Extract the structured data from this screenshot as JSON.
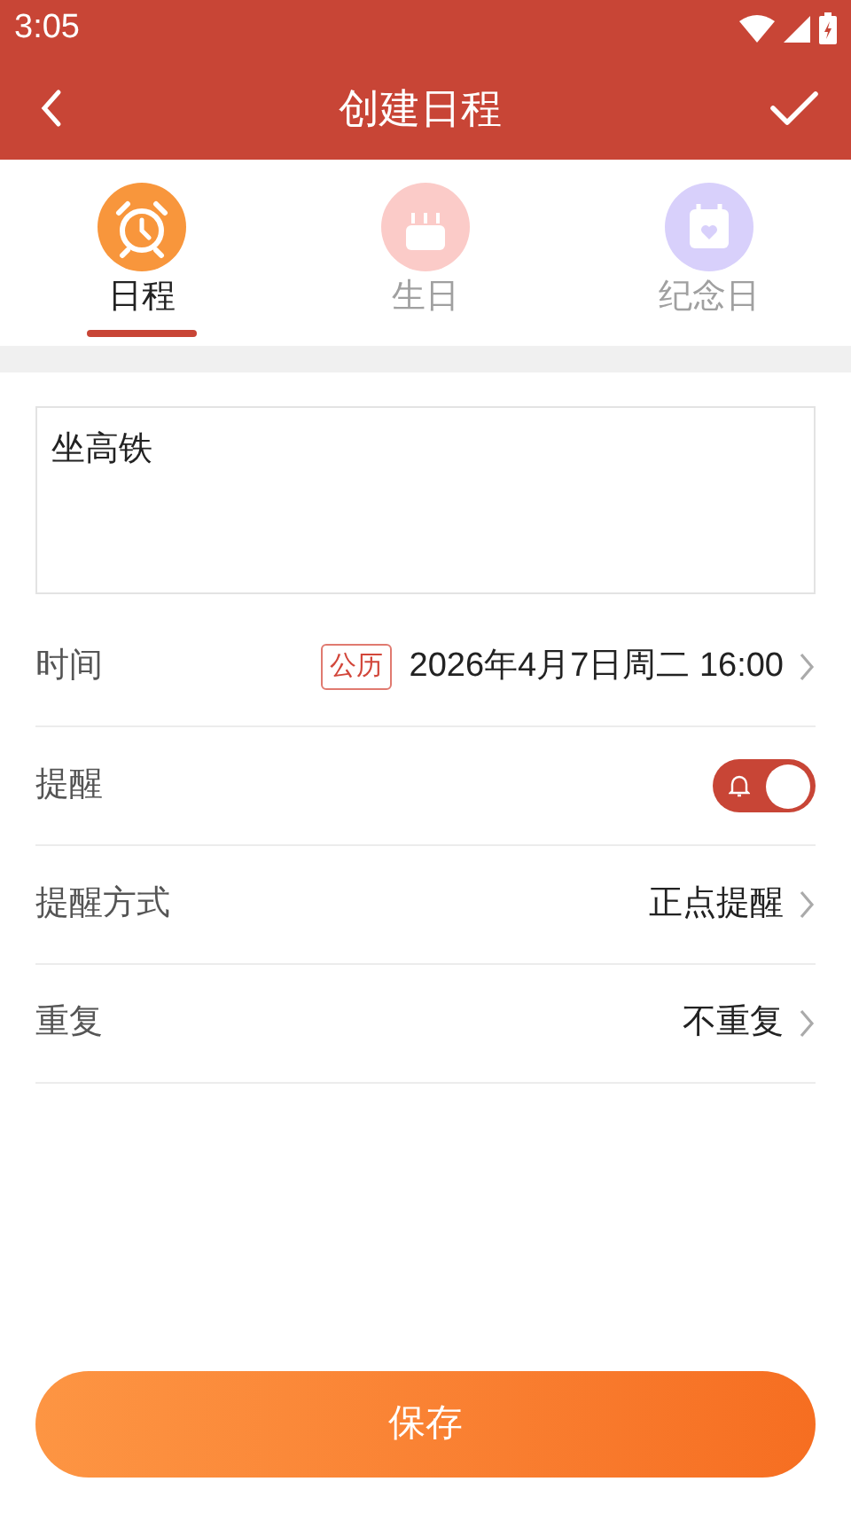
{
  "status_bar": {
    "time": "3:05"
  },
  "header": {
    "title": "创建日程"
  },
  "tabs": [
    {
      "label": "日程",
      "kind": "alarm",
      "selected": true
    },
    {
      "label": "生日",
      "kind": "cake",
      "selected": false
    },
    {
      "label": "纪念日",
      "kind": "calendar",
      "selected": false
    }
  ],
  "note": {
    "value": "坐高铁"
  },
  "rows": [
    {
      "kind": "time",
      "label": "时间",
      "badge": "公历",
      "value": "2026年4月7日周二 16:00"
    },
    {
      "kind": "toggle",
      "label": "提醒",
      "on": true
    },
    {
      "kind": "select",
      "label": "提醒方式",
      "value": "正点提醒"
    },
    {
      "kind": "select",
      "label": "重复",
      "value": "不重复"
    }
  ],
  "save_button": {
    "label": "保存"
  }
}
